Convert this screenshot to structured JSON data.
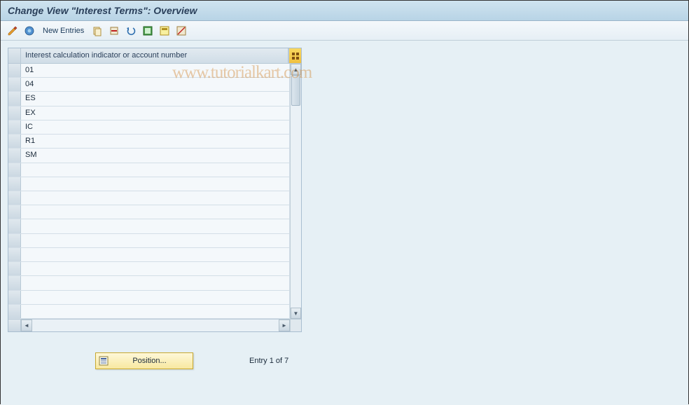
{
  "title": "Change View \"Interest Terms\": Overview",
  "toolbar": {
    "new_entries_label": "New Entries"
  },
  "table": {
    "column_header": "Interest calculation indicator or account number",
    "rows": [
      "01",
      "04",
      "ES",
      "EX",
      "IC",
      "R1",
      "SM",
      "",
      "",
      "",
      "",
      "",
      "",
      "",
      "",
      "",
      "",
      ""
    ]
  },
  "footer": {
    "position_label": "Position...",
    "entry_text": "Entry 1 of 7"
  },
  "watermark": "www.tutorialkart.com"
}
